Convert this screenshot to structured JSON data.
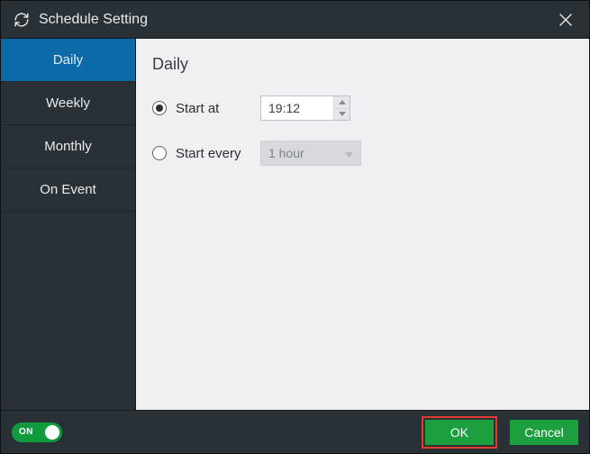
{
  "window": {
    "title": "Schedule Setting"
  },
  "sidebar": {
    "tabs": [
      {
        "label": "Daily",
        "active": true
      },
      {
        "label": "Weekly",
        "active": false
      },
      {
        "label": "Monthly",
        "active": false
      },
      {
        "label": "On Event",
        "active": false
      }
    ]
  },
  "panel": {
    "heading": "Daily",
    "start_at": {
      "label": "Start at",
      "selected": true,
      "time": "19:12"
    },
    "start_every": {
      "label": "Start every",
      "selected": false,
      "value": "1 hour"
    }
  },
  "footer": {
    "toggle": {
      "state": "ON",
      "on": true
    },
    "ok": "OK",
    "cancel": "Cancel"
  }
}
